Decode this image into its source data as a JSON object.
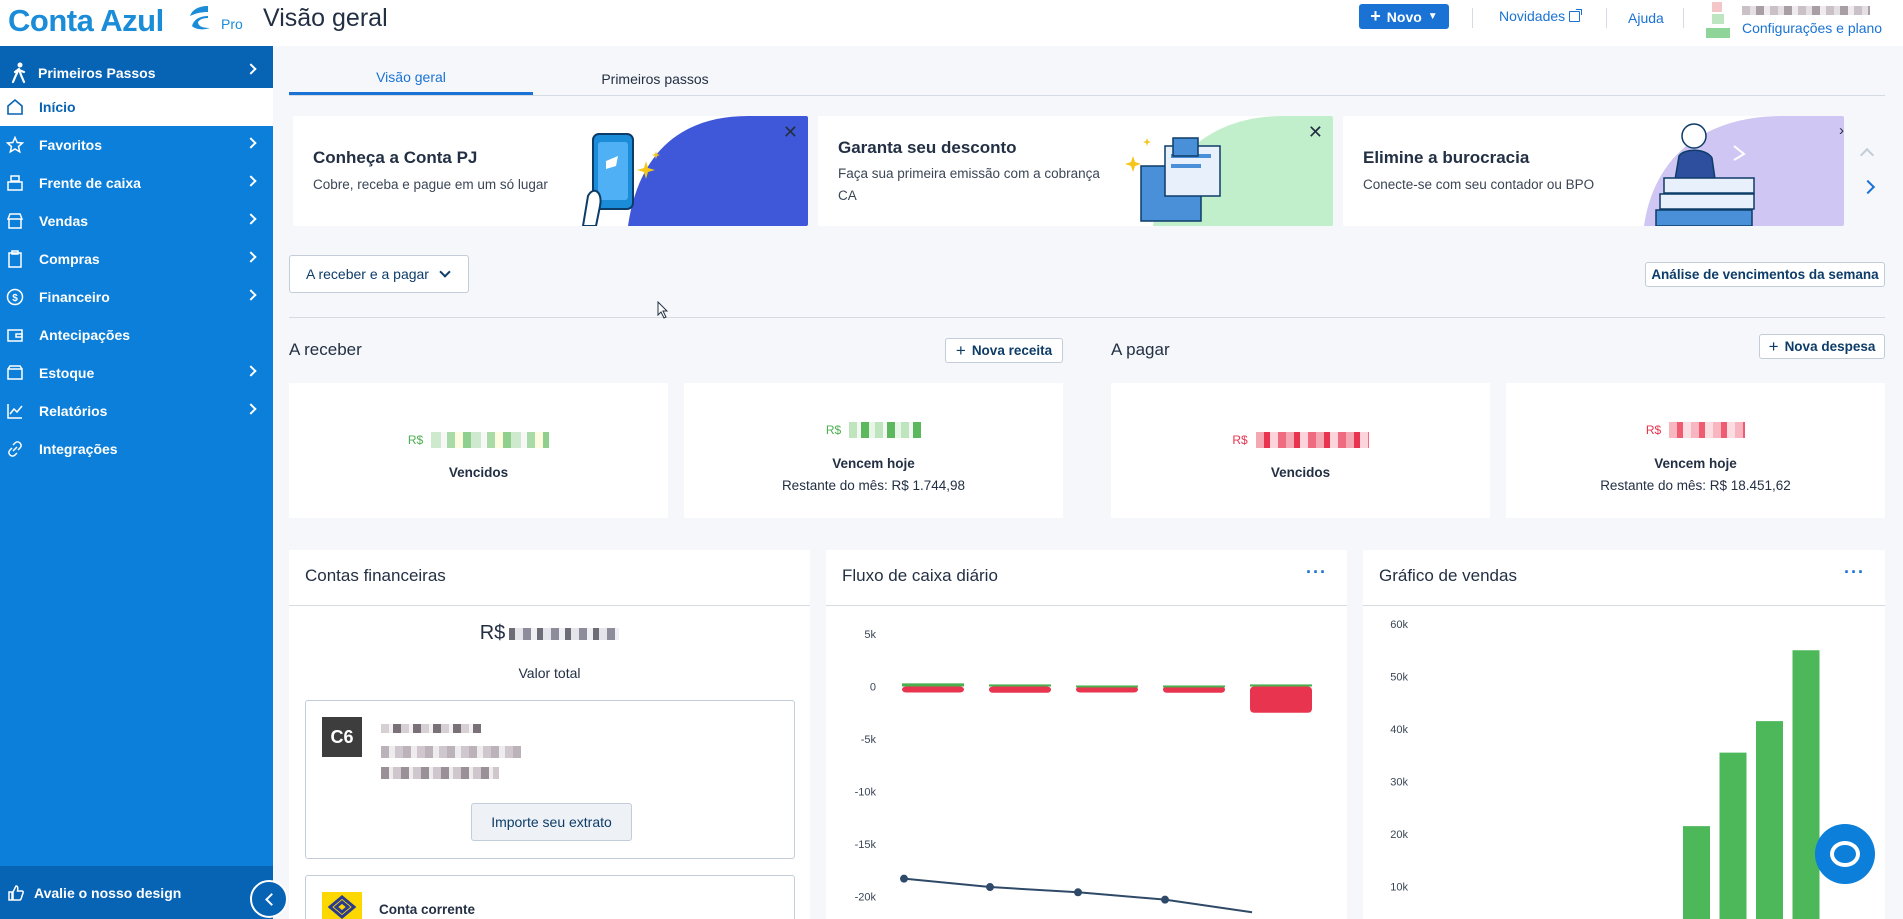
{
  "header": {
    "brand": "Conta Azul",
    "plan": "Pro",
    "title": "Visão geral",
    "new_button": "Novo",
    "novidades": "Novidades",
    "ajuda": "Ajuda",
    "config": "Configurações e plano"
  },
  "sidebar": {
    "first_steps": "Primeiros Passos",
    "items": [
      {
        "label": "Início",
        "icon": "home-icon",
        "active": true,
        "arrow": false
      },
      {
        "label": "Favoritos",
        "icon": "star-icon",
        "arrow": true
      },
      {
        "label": "Frente de caixa",
        "icon": "cash-register-icon",
        "arrow": true
      },
      {
        "label": "Vendas",
        "icon": "store-icon",
        "arrow": true
      },
      {
        "label": "Compras",
        "icon": "clipboard-icon",
        "arrow": true
      },
      {
        "label": "Financeiro",
        "icon": "dollar-circle-icon",
        "arrow": true
      },
      {
        "label": "Antecipações",
        "icon": "wallet-icon",
        "arrow": false
      },
      {
        "label": "Estoque",
        "icon": "box-icon",
        "arrow": true
      },
      {
        "label": "Relatórios",
        "icon": "line-chart-icon",
        "arrow": true
      },
      {
        "label": "Integrações",
        "icon": "link-icon",
        "arrow": false
      }
    ],
    "rate_design": "Avalie o nosso design"
  },
  "tabs": [
    "Visão geral",
    "Primeiros passos"
  ],
  "banners": [
    {
      "title": "Conheça a Conta PJ",
      "subtitle": "Cobre, receba e pague em um só lugar",
      "subtitle2": "",
      "color": "#3f57d9"
    },
    {
      "title": "Garanta seu desconto",
      "subtitle": "Faça sua primeira emissão com a cobrança",
      "subtitle2": "CA",
      "color": "#c2efcb"
    },
    {
      "title": "Elimine a burocracia",
      "subtitle": "Conecte-se com seu contador ou BPO",
      "subtitle2": "",
      "color": "#cfc6f3"
    }
  ],
  "filter": {
    "dropdown": "A receber e a pagar",
    "weekly_analysis": "Análise de vencimentos da semana"
  },
  "receivable": {
    "title": "A receber",
    "new_button": "Nova receita",
    "currency": "R$",
    "overdue_label": "Vencidos",
    "today_label": "Vencem hoje",
    "month_remaining": "Restante do mês: R$ 1.744,98",
    "color": "#4caf50"
  },
  "payable": {
    "title": "A pagar",
    "new_button": "Nova despesa",
    "currency": "R$",
    "overdue_label": "Vencidos",
    "today_label": "Vencem hoje",
    "month_remaining": "Restante do mês: R$ 18.451,62",
    "color": "#e8344e"
  },
  "accounts": {
    "title": "Contas financeiras",
    "currency": "R$",
    "total_label": "Valor total",
    "bank1_logo": "C6",
    "import_button": "Importe seu extrato",
    "bank2_name": "Conta corrente"
  },
  "cashflow": {
    "title": "Fluxo de caixa diário",
    "more": "···"
  },
  "sales": {
    "title": "Gráfico de vendas",
    "more": "···"
  },
  "chart_data": [
    {
      "type": "bar",
      "title": "Fluxo de caixa diário",
      "yticks": [
        "5k",
        "0",
        "-5k",
        "-10k",
        "-15k",
        "-20k"
      ],
      "ylim": [
        -20000,
        5000
      ],
      "series": [
        {
          "values": [
            300,
            200,
            100,
            100,
            200
          ],
          "color": "#4caf50"
        },
        {
          "values": [
            -300,
            -600,
            -400,
            -600,
            -2500
          ],
          "color": "#e8344e"
        },
        {
          "values": [
            -18300,
            -19100,
            -19600,
            -20300,
            -21500
          ],
          "color": "#2f4a68"
        }
      ]
    },
    {
      "type": "bar",
      "title": "Gráfico de vendas",
      "yticks": [
        "60k",
        "50k",
        "40k",
        "30k",
        "20k",
        "10k"
      ],
      "ylim": [
        10000,
        60000
      ],
      "values": [
        21500,
        35500,
        41500,
        55000
      ],
      "color": "#4cb85a"
    }
  ]
}
